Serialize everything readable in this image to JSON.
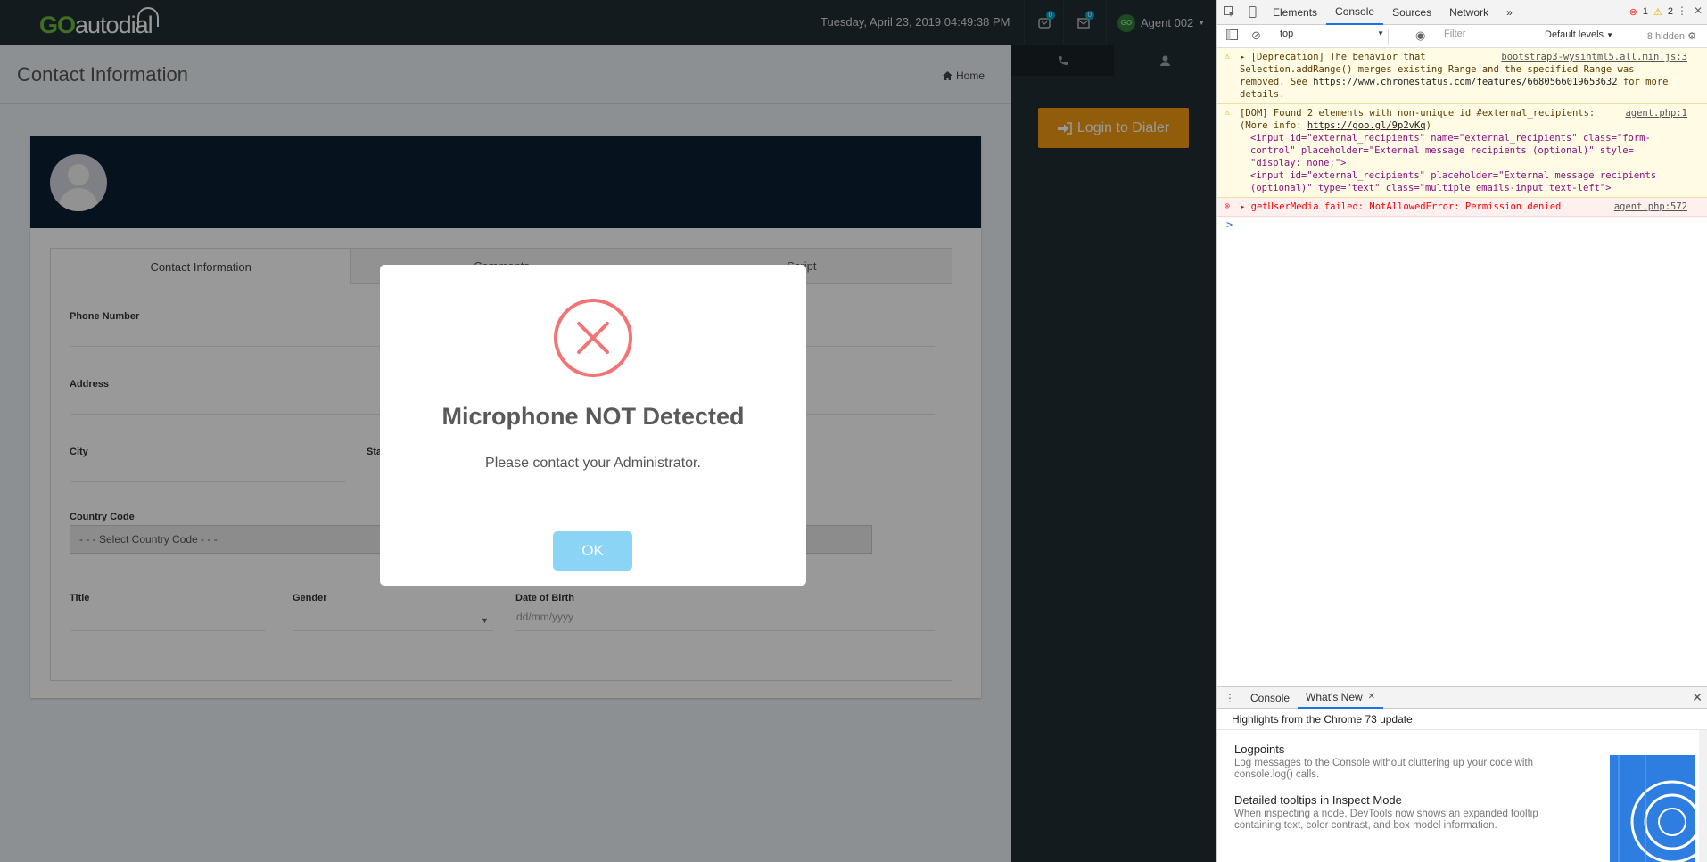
{
  "app": {
    "logo": {
      "go": "GO",
      "rest": "autodial"
    },
    "datetime": "Tuesday, April 23, 2019 04:49:38 PM",
    "topbar_icons": [
      {
        "name": "phone-icon",
        "badge": "0"
      },
      {
        "name": "mail-icon",
        "badge": "0"
      }
    ],
    "user": {
      "initials": "GO",
      "name": "Agent 002"
    },
    "page_title": "Contact Information",
    "breadcrumb": "Home",
    "tabs": [
      "Contact Information",
      "Comments",
      "Script"
    ],
    "fields": {
      "phone_number": "Phone Number",
      "address": "Address",
      "city": "City",
      "state": "Sta",
      "country_code": "Country Code",
      "country_select": "- - - Select Country Code - - -",
      "title": "Title",
      "gender": "Gender",
      "dob": "Date of Birth",
      "dob_placeholder": "dd/mm/yyyy"
    },
    "login_dialer": "Login to Dialer"
  },
  "modal": {
    "title": "Microphone NOT Detected",
    "text": "Please contact your Administrator.",
    "ok": "OK",
    "colors": {
      "error": "#f27474",
      "ok": "#8cd4f5"
    }
  },
  "devtools": {
    "tabs": [
      "Elements",
      "Console",
      "Sources",
      "Network"
    ],
    "more": "»",
    "errors": "1",
    "warnings": "2",
    "context": "top",
    "filter_placeholder": "Filter",
    "levels": "Default levels",
    "hidden": "8 hidden",
    "logs": {
      "l1": {
        "src": "bootstrap3-wysihtml5.all.min.js:3",
        "t1": "[Deprecation] The behavior that\nSelection.addRange() merges existing Range and the specified Range was\nremoved. See ",
        "link": "https://www.chromestatus.com/features/6680566019653632",
        "t2": " for more\ndetails."
      },
      "l2": {
        "src": "agent.php:1",
        "t1": "[DOM] Found 2 elements with non-unique id #external_recipients:\n(More info: ",
        "link": "https://goo.gl/9p2vKq",
        "t2": ")",
        "code1": "<input id=\"external_recipients\" name=\"external_recipients\" class=\"form-\ncontrol\" placeholder=\"External message recipients (optional)\" style=\n\"display: none;\">",
        "code2": "<input id=\"external_recipients\" placeholder=\"External message recipients\n(optional)\" type=\"text\" class=\"multiple_emails-input text-left\">"
      },
      "l3": {
        "src": "agent.php:572",
        "t1": "getUserMedia failed: NotAllowedError: Permission denied"
      }
    },
    "prompt": ">",
    "drawer": {
      "tabs": [
        "Console",
        "What's New"
      ],
      "heading": "Highlights from the Chrome 73 update",
      "items": [
        {
          "title": "Logpoints",
          "desc": "Log messages to the Console without cluttering up your code with console.log() calls."
        },
        {
          "title": "Detailed tooltips in Inspect Mode",
          "desc": "When inspecting a node, DevTools now shows an expanded tooltip containing text, color contrast, and box model information."
        }
      ]
    }
  }
}
